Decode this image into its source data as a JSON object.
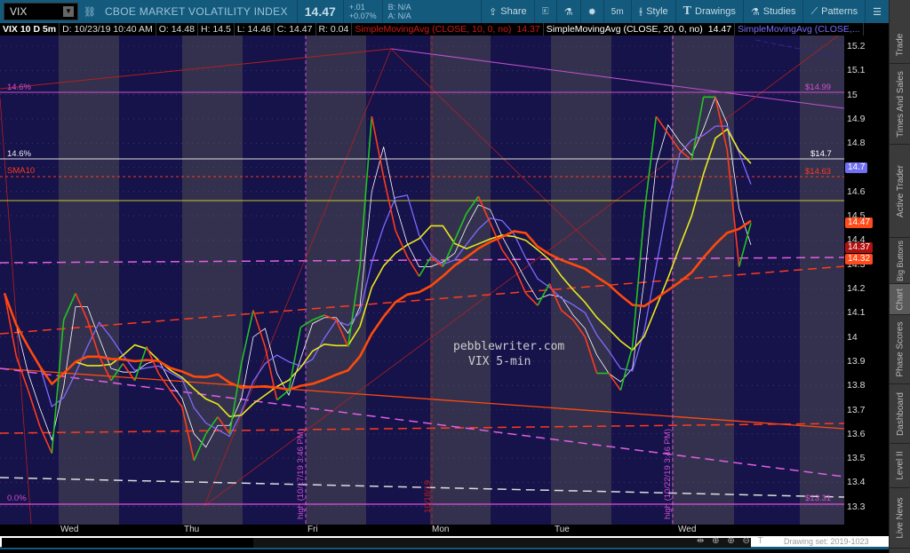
{
  "topbar": {
    "symbol": "VIX",
    "description": "CBOE MARKET VOLATILITY INDEX",
    "last": "14.47",
    "change": "+.01",
    "change_pct": "+0.07%",
    "bid": "B: N/A",
    "ask": "A: N/A",
    "buttons": [
      {
        "label": "Share",
        "icon": "share-icon"
      },
      {
        "label": "",
        "icon": "alert-icon"
      },
      {
        "label": "",
        "icon": "flask-icon"
      },
      {
        "label": "",
        "icon": "gear-icon"
      },
      {
        "label": "5m",
        "icon": ""
      },
      {
        "label": "Style",
        "icon": "candle-icon"
      },
      {
        "label": "Drawings",
        "icon": "text-t-icon"
      },
      {
        "label": "Studies",
        "icon": "flask-icon"
      },
      {
        "label": "Patterns",
        "icon": "pattern-icon"
      }
    ]
  },
  "info": {
    "title": "VIX 10 D 5m",
    "date": "D: 10/23/19 10:40 AM",
    "open": "O: 14.48",
    "high": "H: 14.5",
    "low": "L: 14.46",
    "close": "C: 14.47",
    "range": "R: 0.04",
    "sma1": "SimpleMovingAvg (CLOSE, 10, 0, no)",
    "sma1_val": "14.37",
    "sma2": "SimpleMovingAvg (CLOSE, 20, 0, no)",
    "sma2_val": "14.47",
    "sma3": "SimpleMovingAvg (CLOSE,..."
  },
  "axis": {
    "ticks": [
      "15.2",
      "15.1",
      "15",
      "14.9",
      "14.8",
      "14.7",
      "14.6",
      "14.5",
      "14.4",
      "14.3",
      "14.2",
      "14.1",
      "14",
      "13.9",
      "13.8",
      "13.7",
      "13.6",
      "13.5",
      "13.4",
      "13.3"
    ],
    "markers": [
      {
        "label": "14.7",
        "price": 14.7,
        "color": "#6f6ff2"
      },
      {
        "label": "14.47",
        "price": 14.47,
        "color": "#ff4a1a"
      },
      {
        "label": "14.37",
        "price": 14.37,
        "color": "#b01010"
      },
      {
        "label": "14.32",
        "price": 14.32,
        "color": "#ff4a1a"
      }
    ]
  },
  "time_labels": [
    "Wed",
    "Thu",
    "Fri",
    "Mon",
    "Tue",
    "Wed"
  ],
  "annotations": {
    "fib_top": "14.6%",
    "fib_mid": "14.6%",
    "fib_bottom": "0.0%",
    "sma_label": "SMA10",
    "level_1499": "$14.99",
    "level_147": "$14.7",
    "level_1463": "$14.63",
    "level_1331": "$13.31",
    "vline1": "high (10/17/19 3:46 PM)",
    "vline2": "10/18/19",
    "vline3": "high (10/22/19 3:46 PM)",
    "watermark1": "pebblewriter.com",
    "watermark2": "VIX 5-min"
  },
  "chart_data": {
    "type": "line",
    "ylim": [
      13.25,
      15.25
    ],
    "colors": {
      "up": "#22c322",
      "down": "#ff3b1a",
      "sma_fast": "#ffffff",
      "sma_blue": "#7b6bff",
      "sma_yellow": "#e8e81c",
      "sma_orange": "#ff4a0a"
    },
    "close": [
      14.18,
      13.92,
      13.78,
      13.63,
      13.52,
      14.07,
      14.18,
      14.07,
      13.92,
      13.82,
      13.89,
      13.82,
      13.96,
      13.85,
      13.78,
      13.71,
      13.49,
      13.6,
      13.67,
      13.6,
      13.89,
      14.11,
      13.96,
      13.74,
      13.78,
      14.04,
      14.07,
      14.09,
      14.07,
      13.96,
      14.29,
      14.91,
      14.66,
      14.44,
      14.33,
      14.25,
      14.33,
      14.29,
      14.4,
      14.51,
      14.58,
      14.47,
      14.36,
      14.29,
      14.18,
      14.13,
      14.22,
      14.11,
      14.07,
      14.0,
      13.85,
      13.85,
      13.78,
      13.96,
      14.51,
      14.91,
      14.84,
      14.77,
      14.73,
      14.99,
      14.99,
      14.77,
      14.29,
      14.47
    ]
  },
  "drawing_set": "Drawing set: 2019-1023",
  "sidebar": [
    "Trade",
    "Times And Sales",
    "Active Trader",
    "Big Buttons",
    "Chart",
    "Phase Scores",
    "Dashboard",
    "Level II",
    "Live News"
  ]
}
